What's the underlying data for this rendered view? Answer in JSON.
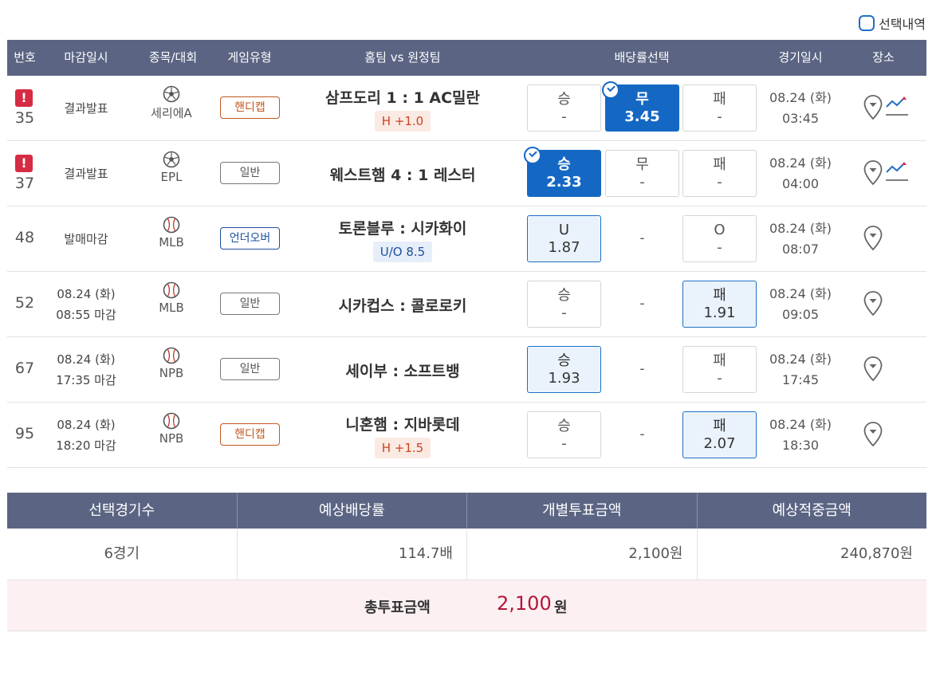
{
  "selection_toggle": {
    "label": "선택내역"
  },
  "table": {
    "headers": {
      "no": "번호",
      "deadline": "마감일시",
      "sport": "종목/대회",
      "type": "게임유형",
      "match": "홈팀 vs 원정팀",
      "odds": "배당률선택",
      "date": "경기일시",
      "place": "장소"
    },
    "rows": [
      {
        "no": "35",
        "alert": true,
        "deadline1": "결과발표",
        "deadline2": "",
        "sport_icon": "soccer-ball-icon",
        "league": "세리에A",
        "type": "핸디캡",
        "type_style": "handicap",
        "match": "삼프도리 1 : 1 AC밀란",
        "sub": "H +1.0",
        "sub_style": "h",
        "odds": [
          {
            "label": "승",
            "value": "-",
            "state": "none"
          },
          {
            "label": "무",
            "value": "3.45",
            "state": "selected"
          },
          {
            "label": "패",
            "value": "-",
            "state": "none"
          }
        ],
        "date": "08.24 (화)",
        "time": "03:45",
        "trend": true
      },
      {
        "no": "37",
        "alert": true,
        "deadline1": "결과발표",
        "deadline2": "",
        "sport_icon": "soccer-ball-icon",
        "league": "EPL",
        "type": "일반",
        "type_style": "normal",
        "match": "웨스트햄 4 : 1 레스터",
        "sub": "",
        "sub_style": "",
        "odds": [
          {
            "label": "승",
            "value": "2.33",
            "state": "selected"
          },
          {
            "label": "무",
            "value": "-",
            "state": "none"
          },
          {
            "label": "패",
            "value": "-",
            "state": "none"
          }
        ],
        "date": "08.24 (화)",
        "time": "04:00",
        "trend": true
      },
      {
        "no": "48",
        "alert": false,
        "deadline1": "발매마감",
        "deadline2": "",
        "sport_icon": "baseball-icon",
        "league": "MLB",
        "type": "언더오버",
        "type_style": "ou",
        "match": "토론블루 : 시카화이",
        "sub": "U/O 8.5",
        "sub_style": "uo",
        "odds": [
          {
            "label": "U",
            "value": "1.87",
            "state": "highlight"
          },
          null,
          {
            "label": "O",
            "value": "-",
            "state": "none"
          }
        ],
        "date": "08.24 (화)",
        "time": "08:07",
        "trend": false
      },
      {
        "no": "52",
        "alert": false,
        "deadline1": "08.24 (화)",
        "deadline2": "08:55 마감",
        "sport_icon": "baseball-icon",
        "league": "MLB",
        "type": "일반",
        "type_style": "normal",
        "match": "시카컵스 : 콜로로키",
        "sub": "",
        "sub_style": "",
        "odds": [
          {
            "label": "승",
            "value": "-",
            "state": "none"
          },
          null,
          {
            "label": "패",
            "value": "1.91",
            "state": "highlight"
          }
        ],
        "date": "08.24 (화)",
        "time": "09:05",
        "trend": false
      },
      {
        "no": "67",
        "alert": false,
        "deadline1": "08.24 (화)",
        "deadline2": "17:35 마감",
        "sport_icon": "baseball-icon",
        "league": "NPB",
        "type": "일반",
        "type_style": "normal",
        "match": "세이부 : 소프트뱅",
        "sub": "",
        "sub_style": "",
        "odds": [
          {
            "label": "승",
            "value": "1.93",
            "state": "highlight"
          },
          null,
          {
            "label": "패",
            "value": "-",
            "state": "none"
          }
        ],
        "date": "08.24 (화)",
        "time": "17:45",
        "trend": false
      },
      {
        "no": "95",
        "alert": false,
        "deadline1": "08.24 (화)",
        "deadline2": "18:20 마감",
        "sport_icon": "baseball-icon",
        "league": "NPB",
        "type": "핸디캡",
        "type_style": "handicap",
        "match": "니혼햄 : 지바롯데",
        "sub": "H +1.5",
        "sub_style": "h",
        "odds": [
          {
            "label": "승",
            "value": "-",
            "state": "none"
          },
          null,
          {
            "label": "패",
            "value": "2.07",
            "state": "highlight"
          }
        ],
        "date": "08.24 (화)",
        "time": "18:30",
        "trend": false
      }
    ],
    "empty_cell": "-"
  },
  "summary": {
    "headers": [
      "선택경기수",
      "예상배당률",
      "개별투표금액",
      "예상적중금액"
    ],
    "values": [
      "6경기",
      "114.7배",
      "2,100원",
      "240,870원"
    ],
    "total_label": "총투표금액",
    "total_value": "2,100",
    "total_unit": "원"
  },
  "colors": {
    "header_bg": "#5b6583",
    "selected_odd": "#1468c4",
    "highlight_odd": "#eaf3fb",
    "alert": "#d62b43",
    "total_amount": "#b3163a"
  }
}
